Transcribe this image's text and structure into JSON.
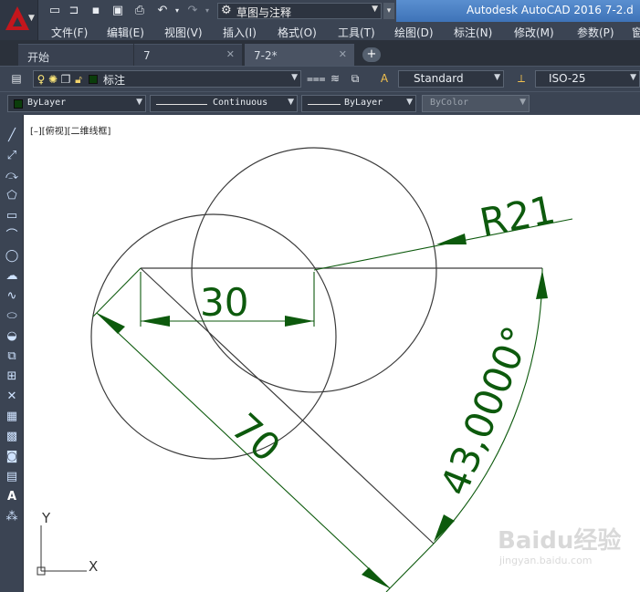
{
  "title_bar": {
    "workspace": "草图与注释",
    "app_title": "Autodesk AutoCAD 2016    7-2.d"
  },
  "menu": [
    "文件(F)",
    "编辑(E)",
    "视图(V)",
    "插入(I)",
    "格式(O)",
    "工具(T)",
    "绘图(D)",
    "标注(N)",
    "修改(M)",
    "参数(P)",
    "窗"
  ],
  "tabs": [
    {
      "label": "开始"
    },
    {
      "label": "7"
    },
    {
      "label": "7-2*"
    }
  ],
  "toolbar1": {
    "layer": "标注",
    "text_style": "Standard",
    "dim_style": "ISO-25"
  },
  "toolbar2": {
    "color": "ByLayer",
    "linetype": "Continuous",
    "lineweight": "ByLayer",
    "plotstyle": "ByColor"
  },
  "canvas": {
    "view_control": "[–][俯视][二维线框]",
    "dimensions": {
      "radius": "R21",
      "linear": "30",
      "aligned": "70",
      "angular": "43,0000°"
    },
    "ucs": {
      "x": "X",
      "y": "Y"
    },
    "watermark": {
      "brand": "Baidu经验",
      "url": "jingyan.baidu.com"
    }
  },
  "colors": {
    "dimension": "#0d5a0d",
    "geometry": "#3a3a3a",
    "ui_dark": "#3b4453",
    "title_blue": "#4a7fc2"
  }
}
